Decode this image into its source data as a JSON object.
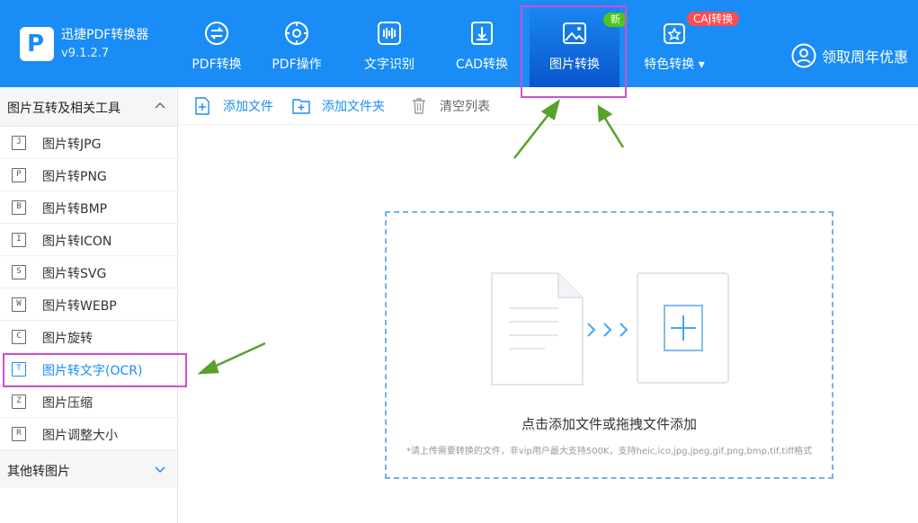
{
  "app": {
    "name": "迅捷PDF转换器",
    "version": "v9.1.2.7"
  },
  "nav": [
    {
      "label": "PDF转换",
      "icon": "pdf-convert-icon"
    },
    {
      "label": "PDF操作",
      "icon": "pdf-operate-icon"
    },
    {
      "label": "文字识别",
      "icon": "ocr-icon"
    },
    {
      "label": "CAD转换",
      "icon": "cad-icon"
    },
    {
      "label": "图片转换",
      "icon": "image-icon",
      "badge": "新",
      "active": true
    },
    {
      "label": "特色转换",
      "icon": "special-icon",
      "badge": "CAJ转换"
    }
  ],
  "promo": {
    "label": "领取周年优惠",
    "icon": "user-icon"
  },
  "sidebar": {
    "section_title": "图片互转及相关工具",
    "items": [
      {
        "label": "图片转JPG",
        "glyph": "J"
      },
      {
        "label": "图片转PNG",
        "glyph": "P"
      },
      {
        "label": "图片转BMP",
        "glyph": "B"
      },
      {
        "label": "图片转ICON",
        "glyph": "I"
      },
      {
        "label": "图片转SVG",
        "glyph": "S"
      },
      {
        "label": "图片转WEBP",
        "glyph": "W"
      },
      {
        "label": "图片旋转",
        "glyph": "C"
      },
      {
        "label": "图片转文字(OCR)",
        "glyph": "T",
        "active": true
      },
      {
        "label": "图片压缩",
        "glyph": "Z"
      },
      {
        "label": "图片调整大小",
        "glyph": "R"
      }
    ],
    "other_section": "其他转图片"
  },
  "toolbar": {
    "add_file": "添加文件",
    "add_folder": "添加文件夹",
    "clear": "清空列表"
  },
  "dropzone": {
    "main": "点击添加文件或拖拽文件添加",
    "sub": "*请上传需要转换的文件，非vip用户最大支持500K，支持heic,ico,jpg,jpeg,gif,png,bmp,tif,tiff格式"
  },
  "colors": {
    "brand": "#1a8cf5",
    "highlight": "#d24dd6",
    "arrow": "#5aa02c",
    "badge_new": "#52c41a",
    "badge_caj": "#ff4d4f"
  }
}
